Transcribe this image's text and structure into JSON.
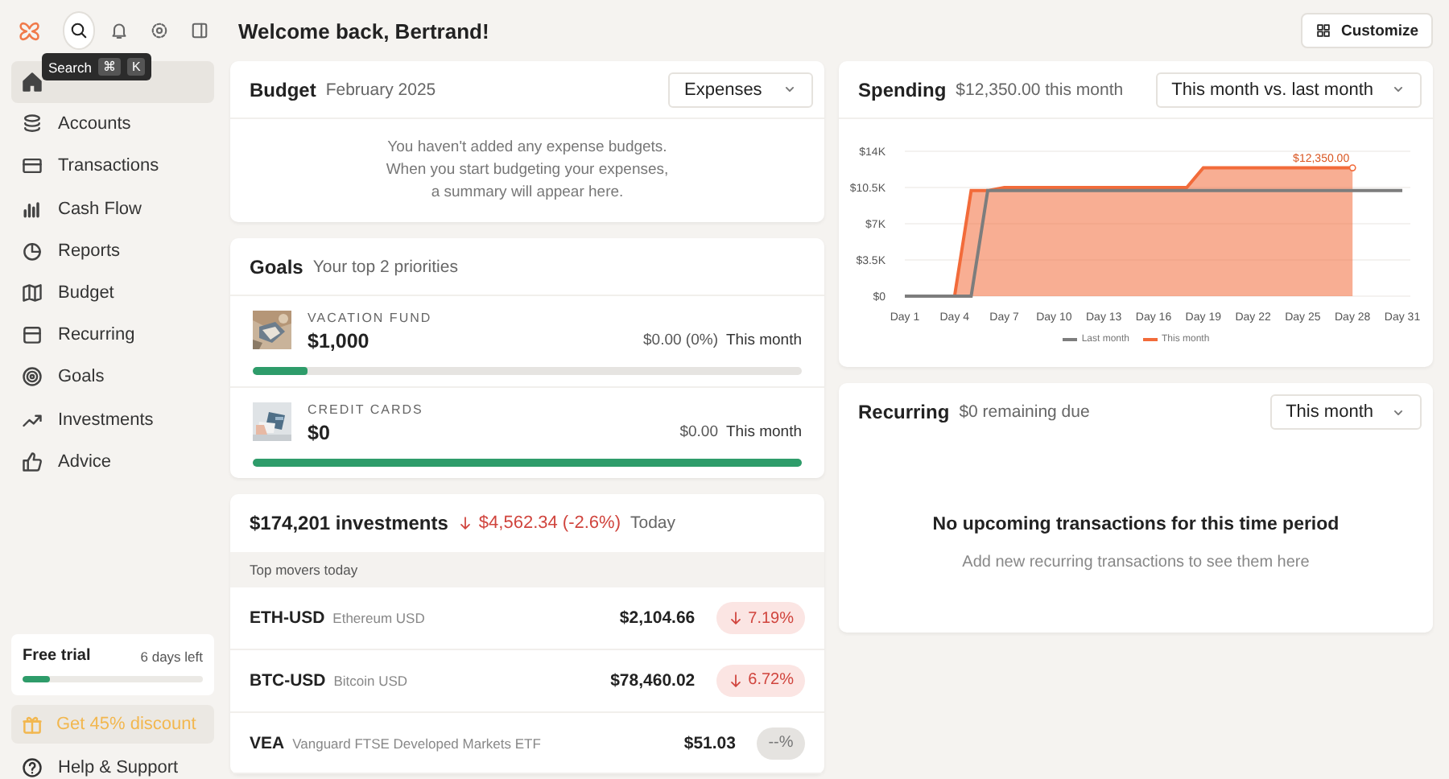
{
  "header": {
    "title": "Welcome back, Bertrand!",
    "customize": "Customize"
  },
  "sidebar": {
    "tooltip": {
      "label": "Search",
      "keys": [
        "⌘",
        "K"
      ]
    },
    "items": [
      {
        "selected": true
      },
      {
        "label": "Accounts",
        "selected": false
      },
      {
        "label": "Transactions",
        "selected": false
      },
      {
        "label": "Cash Flow",
        "selected": false
      },
      {
        "label": "Reports",
        "selected": false
      },
      {
        "label": "Budget",
        "selected": false
      },
      {
        "label": "Recurring",
        "selected": false
      },
      {
        "label": "Goals",
        "selected": false
      },
      {
        "label": "Investments",
        "selected": false
      },
      {
        "label": "Advice",
        "selected": false
      }
    ],
    "trial": {
      "label": "Free trial",
      "remaining": "6 days left",
      "level": 0.15
    },
    "discount": "Get 45% discount",
    "help": "Help & Support"
  },
  "budget": {
    "title": "Budget",
    "period": "February 2025",
    "dropdown": "Expenses",
    "message": "You haven't added any expense budgets. When you start budgeting your expenses, a summary will appear here."
  },
  "goals": {
    "title": "Goals",
    "subtitle": "Your top 2 priorities",
    "items": [
      {
        "name": "VACATION FUND",
        "amount": "$1,000",
        "progress": "$0.00 (0%)",
        "period": "This month",
        "level": 0.1
      },
      {
        "name": "CREDIT CARDS",
        "amount": "$0",
        "progress": "$0.00",
        "period": "This month",
        "level": 1
      }
    ]
  },
  "investments": {
    "total": "$174,201 investments",
    "change": "$4,562.34 (-2.6%)",
    "kind": "down",
    "period": "Today",
    "section": "Top movers today",
    "movers": [
      {
        "symbol": "ETH-USD",
        "name": "Ethereum USD",
        "price": "$2,104.66",
        "change": "7.19%",
        "kind": "down"
      },
      {
        "symbol": "BTC-USD",
        "name": "Bitcoin USD",
        "price": "$78,460.02",
        "change": "6.72%",
        "kind": "down"
      },
      {
        "symbol": "VEA",
        "name": "Vanguard FTSE Developed Markets ETF",
        "price": "$51.03",
        "change": "--%",
        "kind": "flat"
      }
    ]
  },
  "spending": {
    "title": "Spending",
    "subtitle": "$12,350.00 this month",
    "dropdown": "This month vs. last month",
    "chart_data": {
      "type": "area",
      "categories": [
        "Day 1",
        null,
        null,
        "Day 4",
        null,
        null,
        "Day 7",
        null,
        null,
        "Day 10",
        null,
        null,
        "Day 13",
        null,
        null,
        "Day 16",
        null,
        null,
        "Day 19",
        null,
        null,
        "Day 22",
        null,
        null,
        "Day 25",
        null,
        null,
        "Day 28",
        null,
        null,
        "Day 31"
      ],
      "series": [
        {
          "name": "This month",
          "color": "#f26b3a",
          "type": "area",
          "values": [
            0,
            0,
            0,
            0,
            10200,
            10200,
            10500,
            10500,
            10500,
            10500,
            10500,
            10500,
            10500,
            10500,
            10500,
            10500,
            10500,
            10500,
            12400,
            12400,
            12400,
            12400,
            12400,
            12400,
            12400,
            12400,
            12400,
            12400,
            null,
            null,
            null
          ]
        },
        {
          "name": "Last month",
          "color": "#7d7d7d",
          "type": "line",
          "values": [
            0,
            0,
            0,
            0,
            0,
            10200,
            10200,
            10200,
            10200,
            10200,
            10200,
            10200,
            10200,
            10200,
            10200,
            10200,
            10200,
            10200,
            10200,
            10200,
            10200,
            10200,
            10200,
            10200,
            10200,
            10200,
            10200,
            10200,
            10200,
            10200,
            10200
          ]
        }
      ],
      "ylim": [
        0,
        14000
      ],
      "grid": true,
      "legend": true,
      "yticks": [
        {
          "value": 0,
          "label": "$0"
        },
        {
          "value": 3500,
          "label": "$3.5K"
        },
        {
          "value": 7000,
          "label": "$7K"
        },
        {
          "value": 10500,
          "label": "$10.5K"
        },
        {
          "value": 14000,
          "label": "$14K"
        }
      ],
      "annotations": [
        {
          "x": "Day 28",
          "y": 12400,
          "text": "$12,350.00"
        }
      ]
    }
  },
  "recurring": {
    "title": "Recurring",
    "subtitle": "$0 remaining due",
    "dropdown": "This month",
    "empty_title": "No upcoming transactions for this time period",
    "empty_text": "Add new recurring transactions to see them here"
  }
}
